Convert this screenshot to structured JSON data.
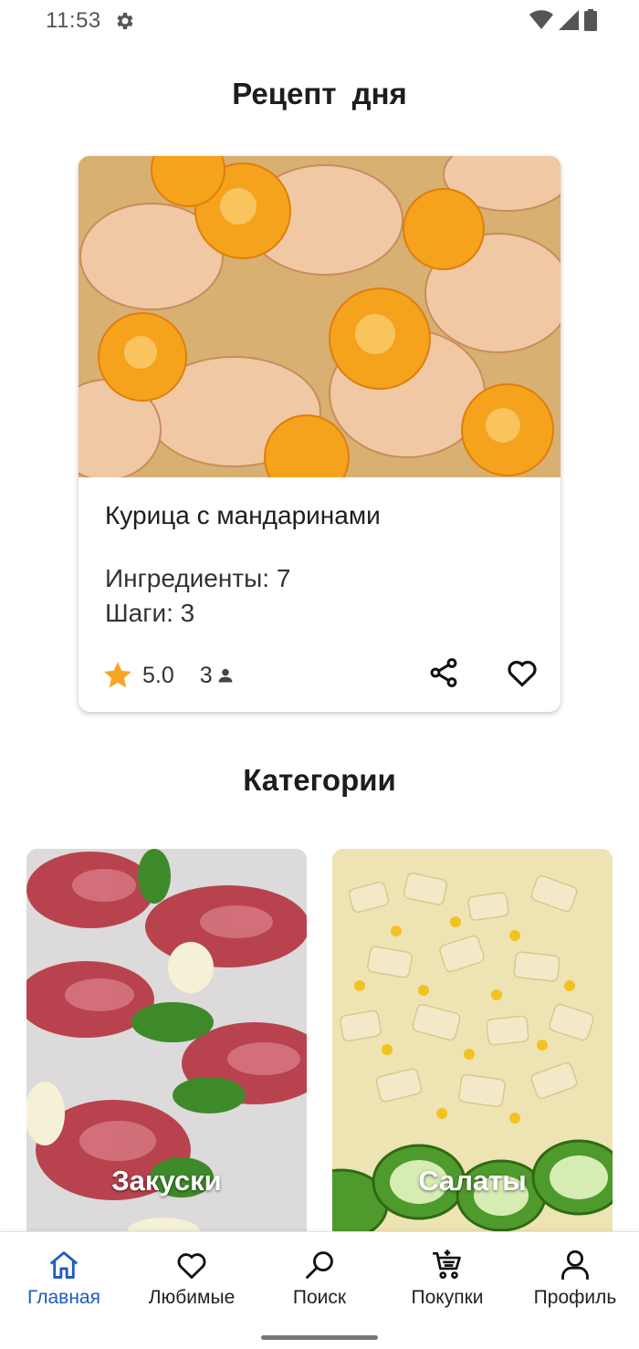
{
  "status_bar": {
    "time": "11:53"
  },
  "recipe_of_day": {
    "title": "Рецепт  дня",
    "name": "Курица с мандаринами",
    "ingredients": "Ингредиенты: 7",
    "steps": "Шаги: 3",
    "rating": "5.0",
    "reviews": "3"
  },
  "categories": {
    "title": "Категории",
    "items": [
      {
        "label": "Закуски"
      },
      {
        "label": "Салаты"
      }
    ]
  },
  "nav": {
    "items": [
      {
        "label": "Главная",
        "icon": "home-icon"
      },
      {
        "label": "Любимые",
        "icon": "heart-icon"
      },
      {
        "label": "Поиск",
        "icon": "search-icon"
      },
      {
        "label": "Покупки",
        "icon": "cart-icon"
      },
      {
        "label": "Профиль",
        "icon": "profile-icon"
      }
    ],
    "active_index": 0
  },
  "colors": {
    "accent": "#1e5bbf",
    "star": "#f5a623",
    "text": "#1d1d1d"
  }
}
